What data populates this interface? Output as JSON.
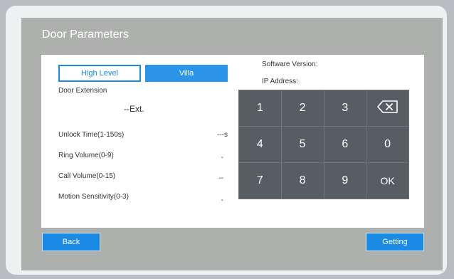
{
  "title": "Door Parameters",
  "tabs": {
    "high_level": "High Level",
    "villa": "Villa"
  },
  "door_extension": {
    "label": "Door Extension",
    "value": "--Ext."
  },
  "fields": {
    "unlock_time": {
      "label": "Unlock Time(1-150s)",
      "value": "---s"
    },
    "ring_volume": {
      "label": "Ring Volume(0-9)",
      "value": "-"
    },
    "call_volume": {
      "label": "Call Volume(0-15)",
      "value": "--"
    },
    "motion_sensitivity": {
      "label": "Motion Sensitivity(0-3)",
      "value": "-"
    }
  },
  "info": {
    "software_version": "Software Version:",
    "ip_address": "IP Address:"
  },
  "keypad": {
    "keys": [
      "1",
      "2",
      "3",
      "backspace",
      "4",
      "5",
      "6",
      "0",
      "7",
      "8",
      "9",
      "OK"
    ],
    "icons": {
      "backspace": "backspace-icon"
    }
  },
  "buttons": {
    "back": "Back",
    "getting": "Getting"
  },
  "colors": {
    "accent": "#1a8ae5",
    "keypad_key": "#575d63",
    "frame": "#aeb0ae"
  }
}
